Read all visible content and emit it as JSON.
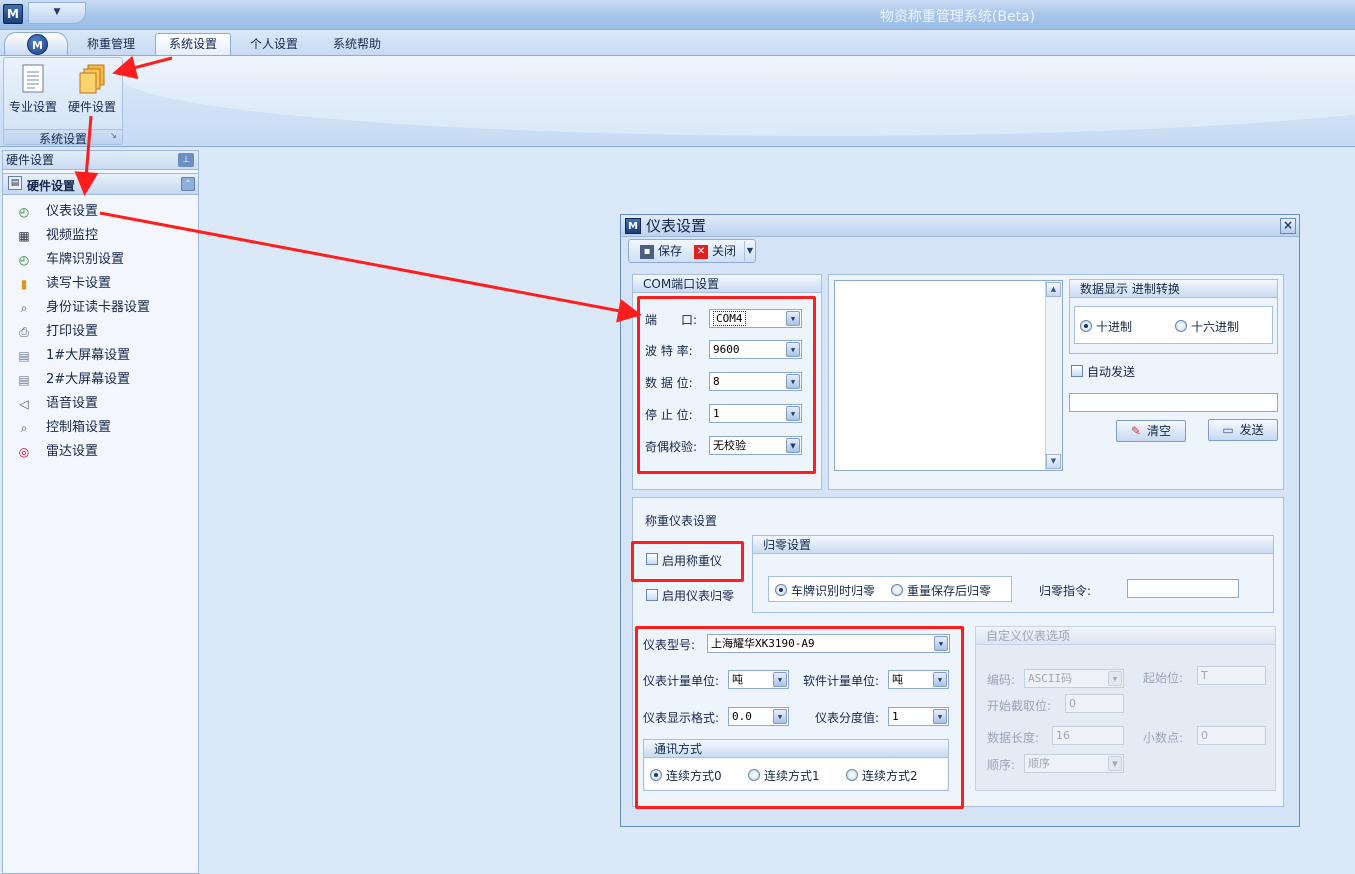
{
  "app": {
    "title": "物资称重管理系统(Beta)",
    "logo_letter": "M",
    "orb_letter": "M"
  },
  "tabs": [
    {
      "label": "称重管理"
    },
    {
      "label": "系统设置",
      "active": true
    },
    {
      "label": "个人设置"
    },
    {
      "label": "系统帮助"
    }
  ],
  "ribbon": {
    "group_label": "系统设置",
    "buttons": [
      {
        "label": "专业设置",
        "icon": "document-icon"
      },
      {
        "label": "硬件设置",
        "icon": "folders-icon"
      }
    ]
  },
  "sidebar": {
    "title": "硬件设置",
    "group_label": "硬件设置",
    "items": [
      {
        "label": "仪表设置",
        "icon": "gauge-icon"
      },
      {
        "label": "视频监控",
        "icon": "film-icon"
      },
      {
        "label": "车牌识别设置",
        "icon": "gauge-icon"
      },
      {
        "label": "读写卡设置",
        "icon": "card-icon"
      },
      {
        "label": "身份证读卡器设置",
        "icon": "search-icon"
      },
      {
        "label": "打印设置",
        "icon": "printer-icon"
      },
      {
        "label": "1#大屏幕设置",
        "icon": "document-icon"
      },
      {
        "label": "2#大屏幕设置",
        "icon": "document-icon"
      },
      {
        "label": "语音设置",
        "icon": "speaker-icon"
      },
      {
        "label": "控制箱设置",
        "icon": "search-icon"
      },
      {
        "label": "雷达设置",
        "icon": "radar-icon"
      }
    ]
  },
  "dialog": {
    "title": "仪表设置",
    "logo_letter": "M",
    "close_glyph": "×",
    "toolbar": {
      "save_label": "保存",
      "close_label": "关闭"
    },
    "com": {
      "header": "COM端口设置",
      "port_label": "端　　口:",
      "port_value": "COM4",
      "baud_label": "波 特 率:",
      "baud_value": "9600",
      "data_label": "数 据 位:",
      "data_value": "8",
      "stop_label": "停 止 位:",
      "stop_value": "1",
      "parity_label": "奇偶校验:",
      "parity_value": "无校验"
    },
    "display": {
      "header": "数据显示 进制转换",
      "decimal_label": "十进制",
      "hex_label": "十六进制",
      "auto_send_label": "自动发送",
      "clear_label": "清空",
      "send_label": "发送"
    },
    "weigh": {
      "section_label": "称重仪表设置",
      "enable_label": "启用称重仪",
      "enable_zero_label": "启用仪表归零",
      "zero": {
        "header": "归零设置",
        "opt1_label": "车牌识别时归零",
        "opt2_label": "重量保存后归零",
        "cmd_label": "归零指令:"
      },
      "model_label": "仪表型号:",
      "model_value": "上海耀华XK3190-A9",
      "meter_unit_label": "仪表计量单位:",
      "meter_unit_value": "吨",
      "soft_unit_label": "软件计量单位:",
      "soft_unit_value": "吨",
      "format_label": "仪表显示格式:",
      "format_value": "0.0",
      "division_label": "仪表分度值:",
      "division_value": "1",
      "comm": {
        "header": "通讯方式",
        "mode0_label": "连续方式0",
        "mode1_label": "连续方式1",
        "mode2_label": "连续方式2"
      },
      "custom": {
        "header": "自定义仪表选项",
        "encoding_label": "编码:",
        "encoding_value": "ASCII码",
        "start_label": "起始位:",
        "start_value": "T",
        "begin_label": "开始截取位:",
        "begin_value": "0",
        "length_label": "数据长度:",
        "length_value": "16",
        "decimal_label": "小数点:",
        "decimal_value": "0",
        "order_label": "顺序:",
        "order_value": "顺序"
      }
    }
  },
  "colors": {
    "annotation": "#ff1e1e",
    "accent": "#1d3f7a",
    "highlight": "#f7d783"
  }
}
